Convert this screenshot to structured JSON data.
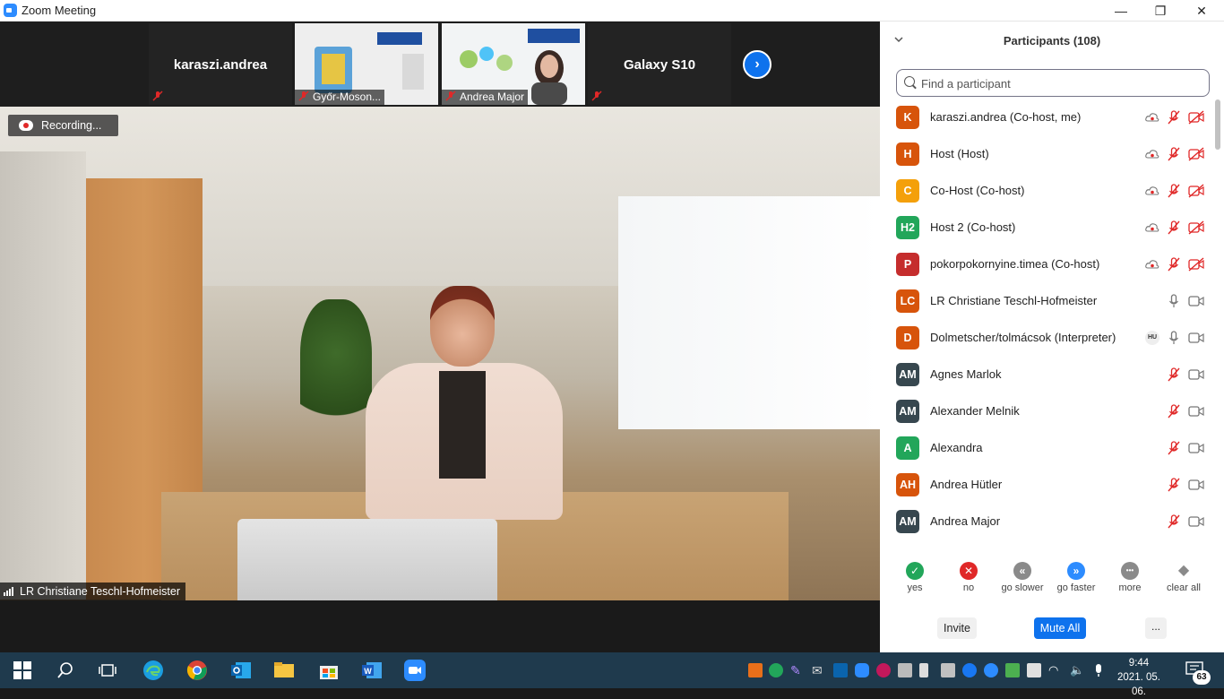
{
  "window": {
    "title": "Zoom Meeting",
    "controls": {
      "minimize": "—",
      "maximize": "❐",
      "close": "✕"
    }
  },
  "gallery_strip": {
    "tiles": [
      {
        "name": "karaszi.andrea",
        "has_video": false
      },
      {
        "label": "Győr-Moson...",
        "has_video": true
      },
      {
        "label": "Andrea Major",
        "has_video": true
      },
      {
        "name": "Galaxy S10",
        "has_video": false
      }
    ],
    "next_page_icon": "chevron-right-icon"
  },
  "recording": {
    "label": "Recording..."
  },
  "active_speaker": {
    "name": "LR Christiane Teschl-Hofmeister"
  },
  "participants_panel": {
    "title": "Participants (108)",
    "search_placeholder": "Find a participant",
    "participants": [
      {
        "initials": "K",
        "color": "#d7540b",
        "name": "karaszi.andrea (Co-host, me)",
        "recording": true,
        "mic": "off",
        "video": "off"
      },
      {
        "initials": "H",
        "color": "#d7540b",
        "name": "Host (Host)",
        "recording": true,
        "mic": "off",
        "video": "off"
      },
      {
        "initials": "C",
        "color": "#f4a00a",
        "name": "Co-Host (Co-host)",
        "recording": true,
        "mic": "off",
        "video": "off"
      },
      {
        "initials": "H2",
        "color": "#22a65a",
        "name": "Host 2 (Co-host)",
        "recording": true,
        "mic": "off",
        "video": "off"
      },
      {
        "initials": "P",
        "color": "#c52d2d",
        "name": "pokorpokornyine.timea (Co-host)",
        "recording": true,
        "mic": "off",
        "video": "off"
      },
      {
        "initials": "LC",
        "color": "#d7540b",
        "name": "LR Christiane Teschl-Hofmeister",
        "recording": false,
        "mic": "on",
        "video": "on"
      },
      {
        "initials": "D",
        "color": "#d7540b",
        "name": "Dolmetscher/tolmácsok (Interpreter)",
        "recording": false,
        "language": "HU",
        "mic": "on",
        "video": "on"
      },
      {
        "initials": "AM",
        "color": "#37474f",
        "name": "Agnes Marlok",
        "recording": false,
        "mic": "off",
        "video": "on"
      },
      {
        "initials": "AM",
        "color": "#37474f",
        "name": "Alexander Melnik",
        "recording": false,
        "mic": "off",
        "video": "on"
      },
      {
        "initials": "A",
        "color": "#22a65a",
        "name": "Alexandra",
        "recording": false,
        "mic": "off",
        "video": "on"
      },
      {
        "initials": "AH",
        "color": "#d7540b",
        "name": "Andrea Hütler",
        "recording": false,
        "mic": "off",
        "video": "on"
      },
      {
        "initials": "AM",
        "color": "#37474f",
        "name": "Andrea Major",
        "recording": false,
        "mic": "off",
        "video": "on"
      }
    ],
    "reactions": [
      {
        "label": "yes",
        "glyph": "✓",
        "color": "#22a65a",
        "icon": "check-icon"
      },
      {
        "label": "no",
        "glyph": "✕",
        "color": "#e02828",
        "icon": "x-icon"
      },
      {
        "label": "go slower",
        "glyph": "«",
        "color": "#8a8a8a",
        "icon": "rewind-icon"
      },
      {
        "label": "go faster",
        "glyph": "»",
        "color": "#2d8cff",
        "icon": "fast-forward-icon"
      },
      {
        "label": "more",
        "glyph": "•••",
        "color": "#8a8a8a",
        "icon": "more-dots-icon"
      },
      {
        "label": "clear all",
        "glyph": "◆",
        "color": "#8a8a8a",
        "icon": "eraser-icon"
      }
    ],
    "buttons": {
      "invite": "Invite",
      "mute_all": "Mute All",
      "more": "..."
    }
  },
  "taskbar": {
    "time": "9:44",
    "date": "2021. 05. 06.",
    "notification_count": "63",
    "pinned_apps": [
      "search-icon",
      "task-view-icon",
      "edge-icon",
      "chrome-icon",
      "outlook-icon",
      "file-explorer-icon",
      "store-icon",
      "word-icon",
      "zoom-icon"
    ]
  }
}
